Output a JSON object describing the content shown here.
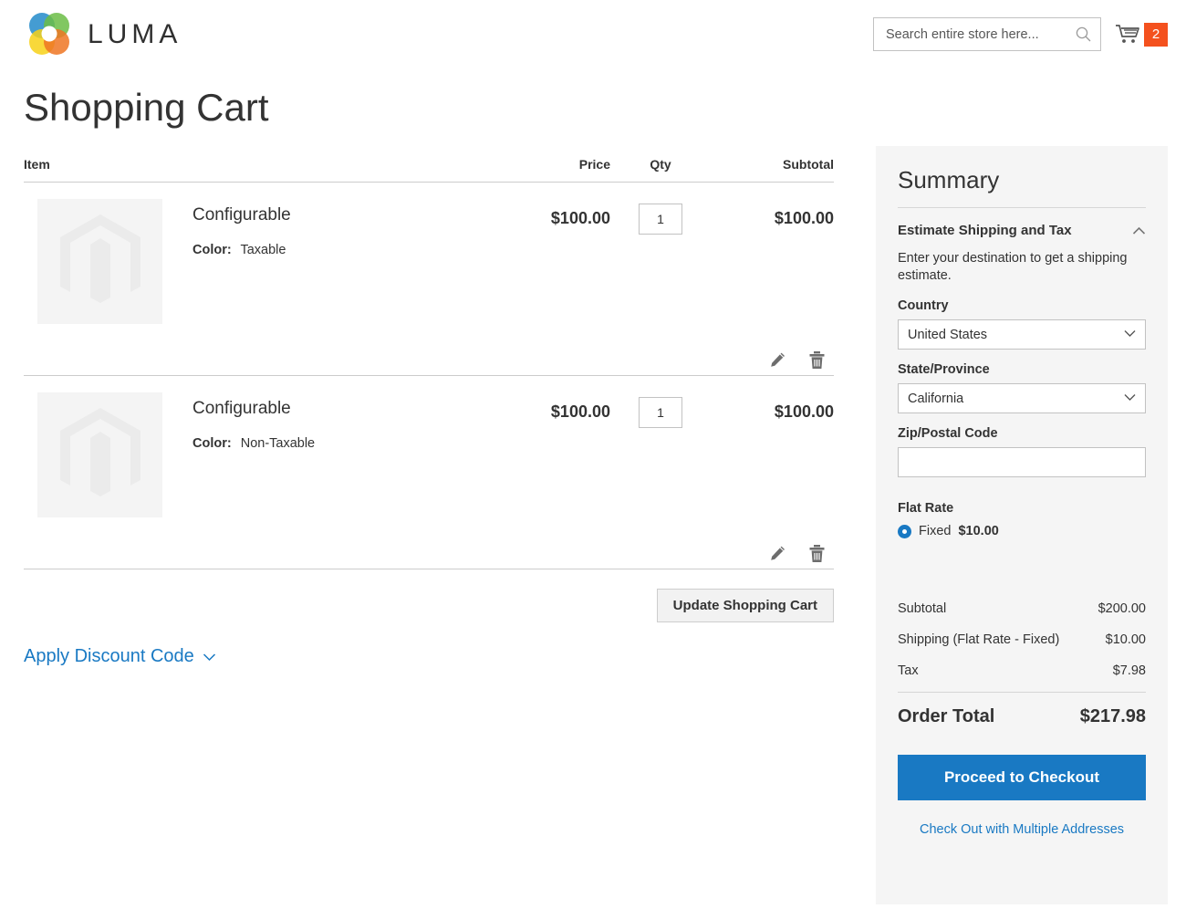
{
  "header": {
    "logo_text": "LUMA",
    "logo_icon": "luma-flower-logo",
    "search": {
      "placeholder": "Search entire store here...",
      "value": "",
      "icon": "search-icon"
    },
    "cart": {
      "icon": "shopping-cart-icon",
      "count": "2",
      "badge_color": "#f4511e"
    }
  },
  "page": {
    "title": "Shopping Cart"
  },
  "cart_table": {
    "columns": {
      "item": "Item",
      "price": "Price",
      "qty": "Qty",
      "subtotal": "Subtotal"
    },
    "rows": [
      {
        "image_icon": "magento-placeholder-image",
        "name": "Configurable",
        "option_label": "Color:",
        "option_value": "Taxable",
        "price": "$100.00",
        "qty": "1",
        "subtotal": "$100.00",
        "edit_icon": "pencil-edit-icon",
        "delete_icon": "trash-delete-icon"
      },
      {
        "image_icon": "magento-placeholder-image",
        "name": "Configurable",
        "option_label": "Color:",
        "option_value": "Non-Taxable",
        "price": "$100.00",
        "qty": "1",
        "subtotal": "$100.00",
        "edit_icon": "pencil-edit-icon",
        "delete_icon": "trash-delete-icon"
      }
    ],
    "update_button": "Update Shopping Cart",
    "discount_toggle": "Apply Discount Code",
    "discount_chevron_icon": "chevron-down-icon"
  },
  "summary": {
    "title": "Summary",
    "estimate": {
      "heading": "Estimate Shipping and Tax",
      "chevron_icon": "chevron-up-icon",
      "note": "Enter your destination to get a shipping estimate.",
      "country_label": "Country",
      "country_value": "United States",
      "state_label": "State/Province",
      "state_value": "California",
      "zip_label": "Zip/Postal Code",
      "zip_value": "",
      "method_title": "Flat Rate",
      "method_name": "Fixed",
      "method_price": "$10.00"
    },
    "totals": [
      {
        "label": "Subtotal",
        "value": "$200.00"
      },
      {
        "label": "Shipping (Flat Rate - Fixed)",
        "value": "$10.00"
      },
      {
        "label": "Tax",
        "value": "$7.98"
      }
    ],
    "grand_total_label": "Order Total",
    "grand_total_value": "$217.98",
    "checkout_button": "Proceed to Checkout",
    "multi_address_link": "Check Out with Multiple Addresses",
    "accent_color": "#1979c3",
    "panel_color": "#f5f5f5"
  }
}
